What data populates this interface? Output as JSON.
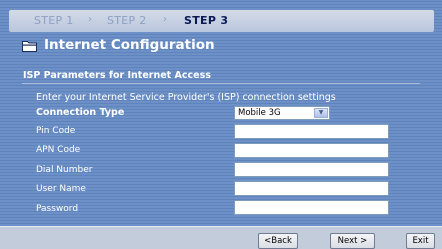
{
  "steps": [
    "STEP 1",
    "STEP 2",
    "STEP 3"
  ],
  "step_separator": "›",
  "page_title": "Internet Configuration",
  "section_title": "ISP Parameters for Internet Access",
  "intro_text": "Enter your Internet Service Provider's (ISP) connection settings",
  "form": {
    "connection_type_label": "Connection Type",
    "connection_type_value": "Mobile 3G",
    "pin_code_label": "Pin Code",
    "pin_code_value": "",
    "apn_code_label": "APN Code",
    "apn_code_value": "",
    "dial_number_label": "Dial Number",
    "dial_number_value": "",
    "user_name_label": "User Name",
    "user_name_value": "",
    "password_label": "Password",
    "password_value": ""
  },
  "buttons": {
    "back": "<Back",
    "next": "Next >",
    "exit": "Exit"
  },
  "colors": {
    "background": "#6d91c7",
    "active_step": "#0b1a55",
    "inactive_step": "#8ea0c2",
    "footer": "#c3ccdb"
  },
  "icons": {
    "title_icon": "folder-icon",
    "dropdown_icon": "chevron-down-icon"
  }
}
